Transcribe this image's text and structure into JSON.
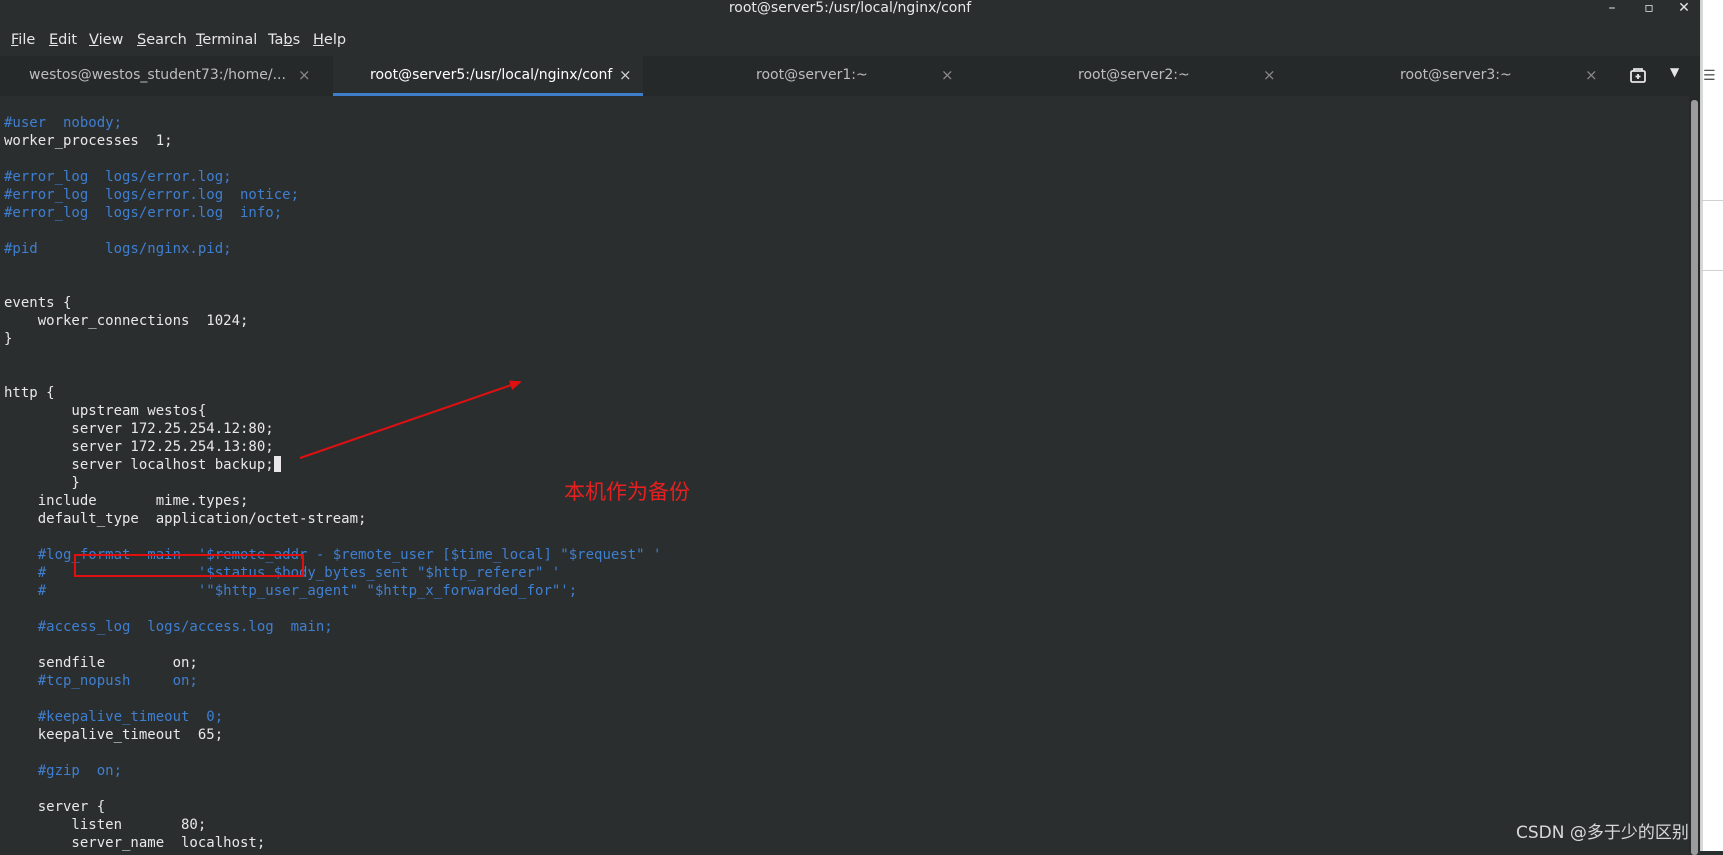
{
  "window": {
    "title": "root@server5:/usr/local/nginx/conf",
    "minimize": "–",
    "maximize": "▫",
    "close": "✕"
  },
  "menu": {
    "file": {
      "pre": "",
      "u": "F",
      "post": "ile"
    },
    "edit": {
      "pre": "",
      "u": "E",
      "post": "dit"
    },
    "view": {
      "pre": "",
      "u": "V",
      "post": "iew"
    },
    "search": {
      "pre": "",
      "u": "S",
      "post": "earch"
    },
    "terminal": {
      "pre": "",
      "u": "T",
      "post": "erminal"
    },
    "tabs": {
      "pre": "Ta",
      "u": "b",
      "post": "s"
    },
    "help": {
      "pre": "",
      "u": "H",
      "post": "elp"
    }
  },
  "tabs": [
    {
      "label": "westos@westos_student73:/home/...",
      "close": "×",
      "active": false
    },
    {
      "label": "root@server5:/usr/local/nginx/conf",
      "close": "×",
      "active": true
    },
    {
      "label": "root@server1:~",
      "close": "×",
      "active": false
    },
    {
      "label": "root@server2:~",
      "close": "×",
      "active": false
    },
    {
      "label": "root@server3:~",
      "close": "×",
      "active": false
    }
  ],
  "tab_menu": "▼",
  "terminal": {
    "lines": [
      {
        "text": "#user  nobody;",
        "comment": true
      },
      {
        "text": "worker_processes  1;",
        "comment": false
      },
      {
        "text": "",
        "comment": false
      },
      {
        "text": "#error_log  logs/error.log;",
        "comment": true
      },
      {
        "text": "#error_log  logs/error.log  notice;",
        "comment": true
      },
      {
        "text": "#error_log  logs/error.log  info;",
        "comment": true
      },
      {
        "text": "",
        "comment": false
      },
      {
        "text": "#pid        logs/nginx.pid;",
        "comment": true
      },
      {
        "text": "",
        "comment": false
      },
      {
        "text": "",
        "comment": false
      },
      {
        "text": "events {",
        "comment": false
      },
      {
        "text": "    worker_connections  1024;",
        "comment": false
      },
      {
        "text": "}",
        "comment": false
      },
      {
        "text": "",
        "comment": false
      },
      {
        "text": "",
        "comment": false
      },
      {
        "text": "http {",
        "comment": false
      },
      {
        "text": "        upstream westos{",
        "comment": false
      },
      {
        "text": "        server 172.25.254.12:80;",
        "comment": false
      },
      {
        "text": "        server 172.25.254.13:80;",
        "comment": false
      },
      {
        "text": "        server localhost backup;",
        "comment": false,
        "cursor": true
      },
      {
        "text": "        }",
        "comment": false
      },
      {
        "text": "    include       mime.types;",
        "comment": false
      },
      {
        "text": "    default_type  application/octet-stream;",
        "comment": false
      },
      {
        "text": "",
        "comment": false
      },
      {
        "text": "    #log_format  main  '$remote_addr - $remote_user [$time_local] \"$request\" '",
        "comment": true
      },
      {
        "text": "    #                  '$status $body_bytes_sent \"$http_referer\" '",
        "comment": true
      },
      {
        "text": "    #                  '\"$http_user_agent\" \"$http_x_forwarded_for\"';",
        "comment": true
      },
      {
        "text": "",
        "comment": false
      },
      {
        "text": "    #access_log  logs/access.log  main;",
        "comment": true
      },
      {
        "text": "",
        "comment": false
      },
      {
        "text": "    sendfile        on;",
        "comment": false
      },
      {
        "text": "    #tcp_nopush     on;",
        "comment": true
      },
      {
        "text": "",
        "comment": false
      },
      {
        "text": "    #keepalive_timeout  0;",
        "comment": true
      },
      {
        "text": "    keepalive_timeout  65;",
        "comment": false
      },
      {
        "text": "",
        "comment": false
      },
      {
        "text": "    #gzip  on;",
        "comment": true
      },
      {
        "text": "",
        "comment": false
      },
      {
        "text": "    server {",
        "comment": false
      },
      {
        "text": "        listen       80;",
        "comment": false
      },
      {
        "text": "        server_name  localhost;",
        "comment": false
      }
    ]
  },
  "annotation": {
    "text": "本机作为备份",
    "color": "#e52020"
  },
  "watermark": "CSDN @多于少的区别",
  "colors": {
    "background": "#2b2e2f",
    "text": "#e8e8e8",
    "comment": "#3f7fd0",
    "active_tab_accent": "#3d7dca"
  }
}
